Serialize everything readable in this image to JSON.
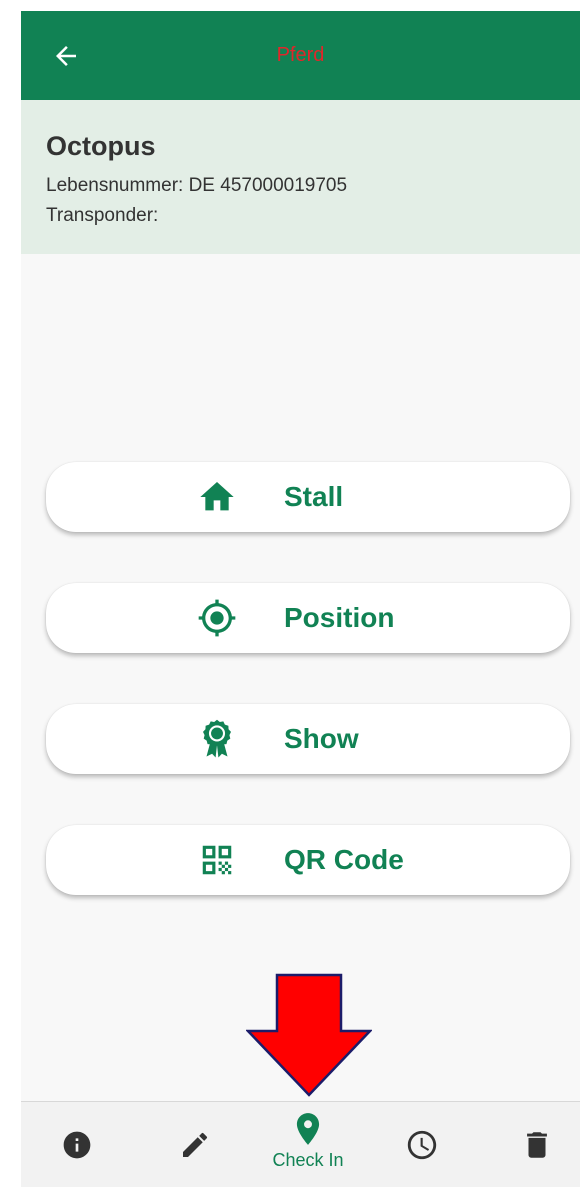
{
  "app_bar": {
    "title": "Pferd",
    "title_color": "#e0262a",
    "background": "#118254",
    "back_icon": "arrow-back-icon"
  },
  "horse": {
    "name": "Octopus",
    "lebensnummer_line": "Lebensnummer: DE 457000019705",
    "transponder_line": "Transponder:"
  },
  "actions": [
    {
      "label": "Stall",
      "icon": "home-icon"
    },
    {
      "label": "Position",
      "icon": "crosshair-icon"
    },
    {
      "label": "Show",
      "icon": "ribbon-award-icon"
    },
    {
      "label": "QR Code",
      "icon": "qr-code-icon"
    }
  ],
  "bottom_nav": {
    "items": [
      {
        "icon": "info-icon"
      },
      {
        "icon": "pencil-icon"
      },
      {
        "icon": "location-pin-icon",
        "label": "Check In",
        "active": true
      },
      {
        "icon": "clock-icon"
      },
      {
        "icon": "trash-icon"
      }
    ]
  },
  "colors": {
    "accent": "#118254",
    "header_tint": "#e3eee6",
    "annotation_arrow": "#ff0000"
  }
}
